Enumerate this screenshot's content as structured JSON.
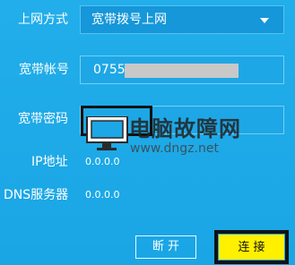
{
  "form": {
    "connection_type_label": "上网方式",
    "connection_type_value": "宽带拨号上网",
    "account_label": "宽带帐号",
    "account_prefix": "0755",
    "password_label": "宽带密码",
    "password_mask": "•••",
    "ip_label": "IP地址",
    "ip_value": "0.0.0.0",
    "dns_label": "DNS服务器",
    "dns_value": "0.0.0.0"
  },
  "buttons": {
    "disconnect": "断 开",
    "connect": "连 接"
  },
  "watermark": {
    "title": "电脑故障网",
    "url": "www.dngz.net"
  },
  "icons": {
    "dropdown": "chevron-down-icon",
    "watermark": "monitor-icon"
  },
  "colors": {
    "background": "#1ea9e8",
    "accent": "#fff000",
    "text": "#ffffff"
  }
}
